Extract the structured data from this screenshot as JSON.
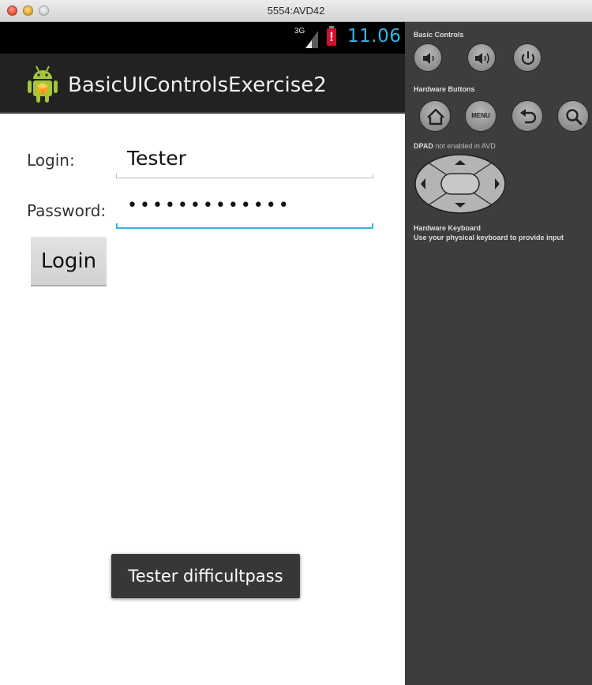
{
  "window": {
    "title": "5554:AVD42"
  },
  "status_bar": {
    "network": "3G",
    "battery_mark": "!",
    "time": "11.06"
  },
  "action_bar": {
    "title": "BasicUIControlsExercise2"
  },
  "form": {
    "login_label": "Login:",
    "login_value": "Tester",
    "password_label": "Password:",
    "password_value": "•••••••••••••",
    "login_button": "Login"
  },
  "toast": {
    "text": "Tester difficultpass"
  },
  "emulator_panel": {
    "basic_controls_label": "Basic Controls",
    "hardware_buttons_label": "Hardware Buttons",
    "menu_label": "MENU",
    "dpad_label_bold": "DPAD",
    "dpad_label_rest": "not enabled in AVD",
    "keyboard_label": "Hardware Keyboard",
    "keyboard_hint": "Use your physical keyboard to provide input",
    "icons": [
      "volume-down-icon",
      "volume-up-icon",
      "power-icon",
      "home-icon",
      "menu-icon",
      "back-icon",
      "search-icon"
    ]
  },
  "colors": {
    "accent": "#33b5e5",
    "toast_bg": "#373737",
    "panel_bg": "#3d3d3d"
  }
}
